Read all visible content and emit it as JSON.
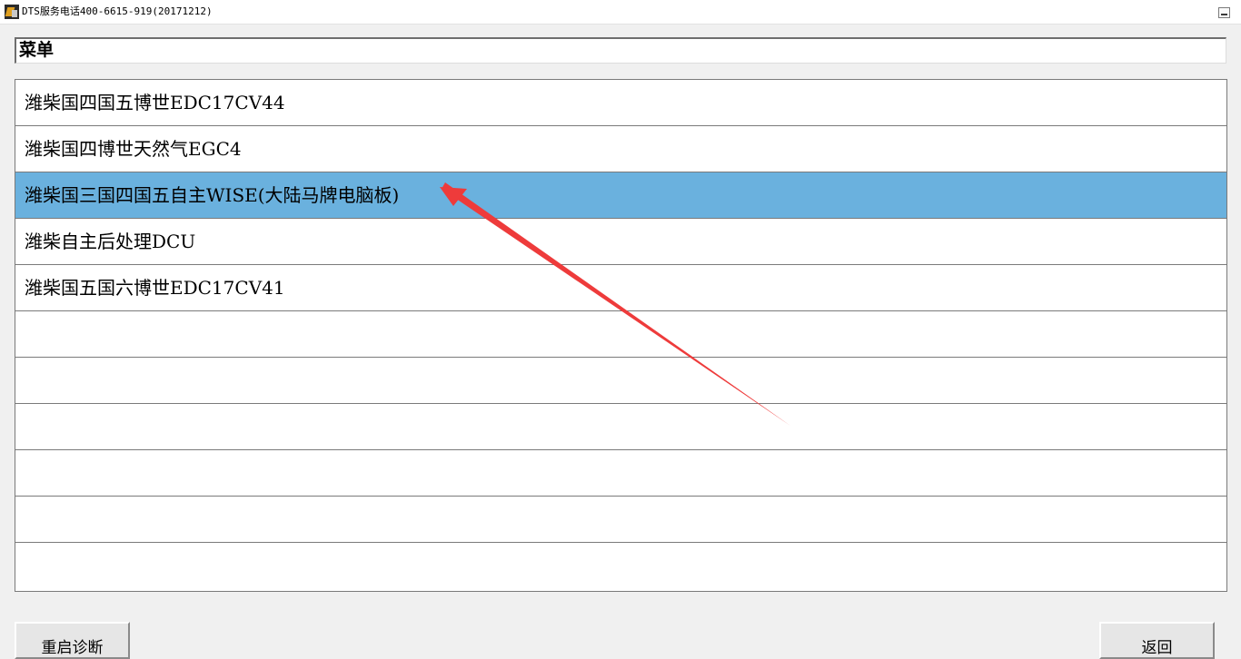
{
  "window": {
    "title": "DTS服务电话400-6615-919(20171212)",
    "icon": "app-logo-icon"
  },
  "menu": {
    "header": "菜单",
    "items": [
      "潍柴国四国五博世EDC17CV44",
      "潍柴国四博世天然气EGC4",
      "潍柴国三国四国五自主WISE(大陆马牌电脑板)",
      "潍柴自主后处理DCU",
      "潍柴国五国六博世EDC17CV41",
      "",
      "",
      "",
      "",
      "",
      ""
    ],
    "selected_index": 2
  },
  "buttons": {
    "restart": "重启诊断",
    "back": "返回"
  },
  "colors": {
    "selection": "#6ab1de",
    "annotation_arrow": "#ee3b3b"
  }
}
